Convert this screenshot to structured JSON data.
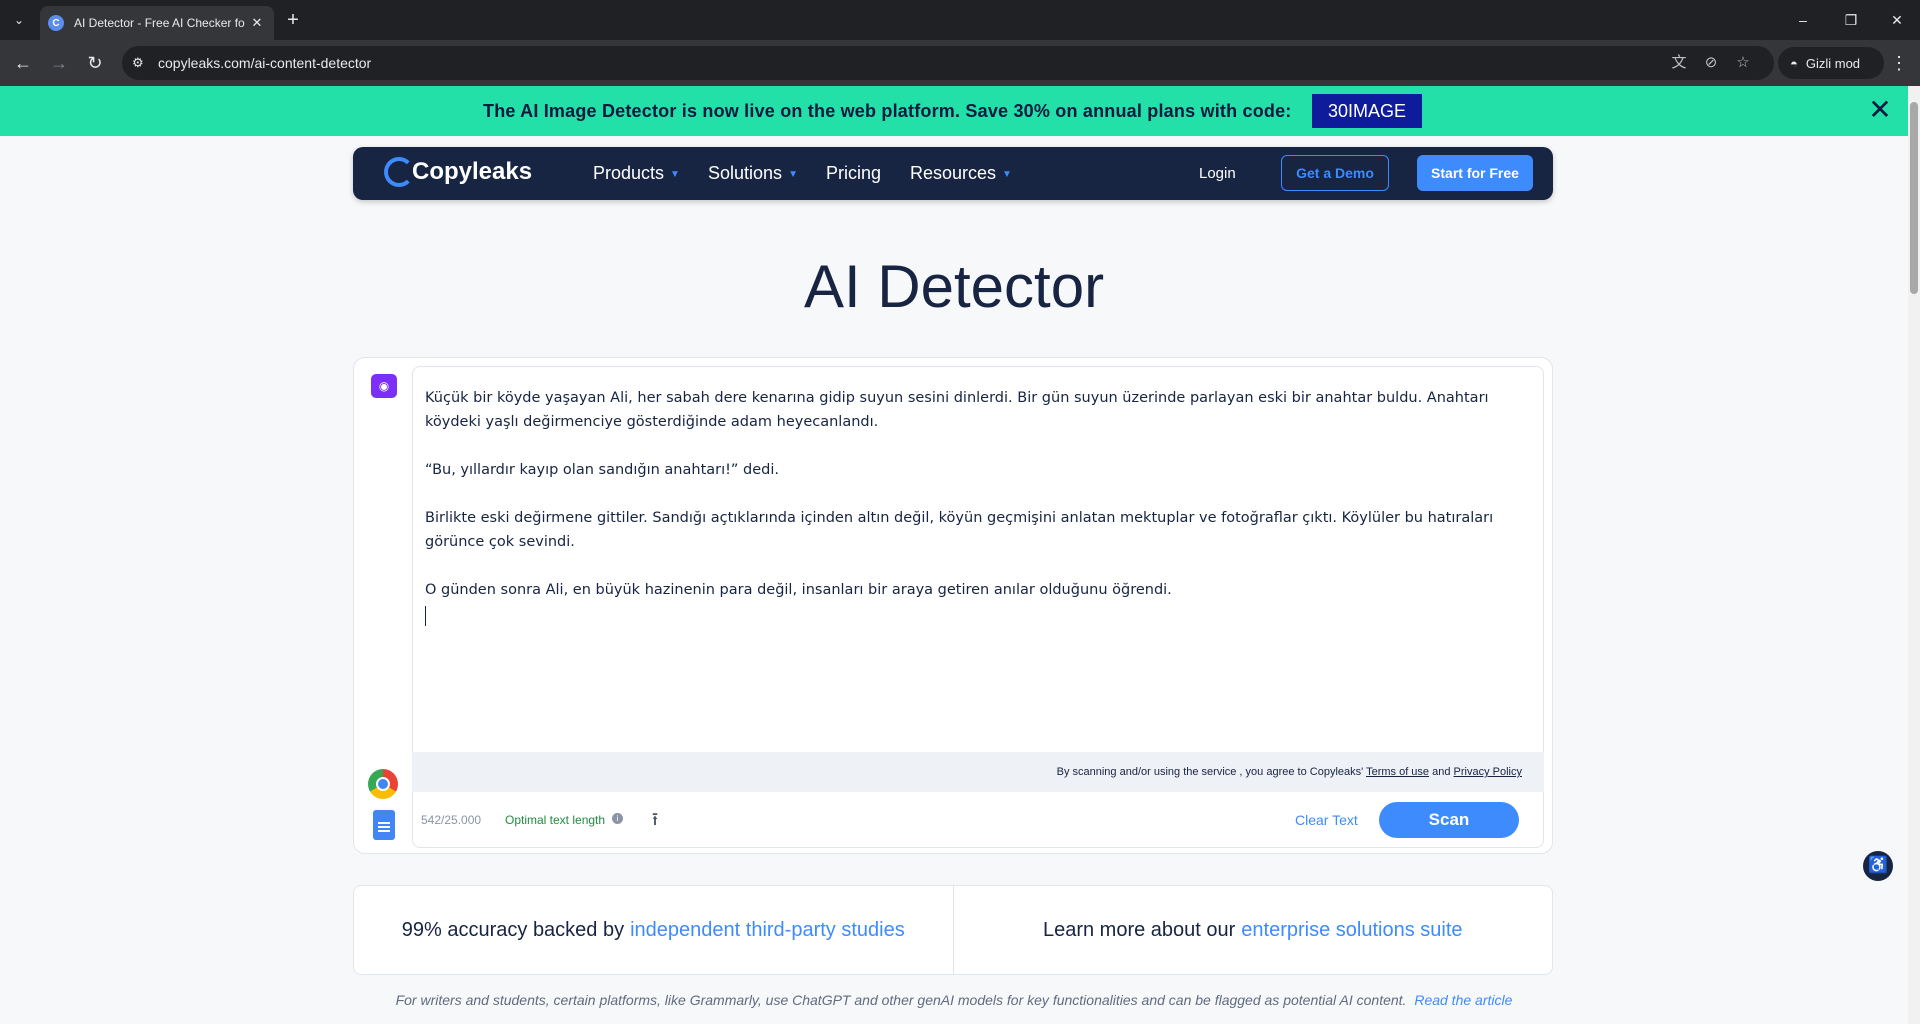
{
  "browser": {
    "tab_title": "AI Detector - Free AI Checker fo",
    "tab_favicon": "C",
    "url": "copyleaks.com/ai-content-detector",
    "incognito_label": "Gizli mod"
  },
  "banner": {
    "text": "The AI Image Detector is now live on the web platform. Save 30% on annual plans with code:",
    "code": "30IMAGE",
    "background": "#22e0a8"
  },
  "nav": {
    "logo_text": "Copyleaks",
    "items": [
      "Products",
      "Solutions",
      "Pricing",
      "Resources"
    ],
    "login": "Login",
    "demo": "Get a Demo",
    "start": "Start for Free"
  },
  "page": {
    "title": "AI Detector"
  },
  "editor": {
    "paragraphs": [
      "Küçük bir köyde yaşayan Ali, her sabah dere kenarına gidip suyun sesini dinlerdi. Bir gün suyun üzerinde parlayan eski bir anahtar buldu. Anahtarı köydeki yaşlı değirmenciye gösterdiğinde adam heyecanlandı.",
      "“Bu, yıllardır kayıp olan sandığın anahtarı!” dedi.",
      "Birlikte eski değirmene gittiler. Sandığı açtıklarında içinden altın değil, köyün geçmişini anlatan mektuplar ve fotoğraflar çıktı. Köylüler bu hatıraları görünce çok sevindi.",
      "O günden sonra Ali, en büyük hazinenin para değil, insanları bir araya getiren anılar olduğunu öğrendi."
    ],
    "consent_prefix": "By scanning and/or using the service , you agree to Copyleaks'",
    "terms_link": "Terms of use",
    "consent_and": "and",
    "privacy_link": "Privacy Policy",
    "char_count": "542/25.000",
    "length_status": "Optimal text length",
    "clear": "Clear Text",
    "scan": "Scan"
  },
  "info": {
    "left_prefix": "99% accuracy backed by",
    "left_link": "independent third-party studies",
    "right_prefix": "Learn more about our",
    "right_link": "enterprise solutions suite"
  },
  "footnote": {
    "text": "For writers and students, certain platforms, like Grammarly, use ChatGPT and other genAI models for key functionalities and can be flagged as potential AI content.",
    "link": "Read the article"
  },
  "icons": [
    "tab-list-icon",
    "close-icon",
    "plus-icon",
    "minimize-icon",
    "restore-icon",
    "back-icon",
    "forward-icon",
    "reload-icon",
    "site-info-icon",
    "translate-icon",
    "eye-off-icon",
    "star-icon",
    "incognito-icon",
    "menu-icon",
    "eye-icon",
    "chrome-icon",
    "google-docs-icon",
    "info-icon",
    "upload-icon",
    "accessibility-icon"
  ],
  "colors": {
    "brand_navy": "#172442",
    "accent_blue": "#3d8bfd",
    "promo_code_bg": "#0e1c9c"
  }
}
